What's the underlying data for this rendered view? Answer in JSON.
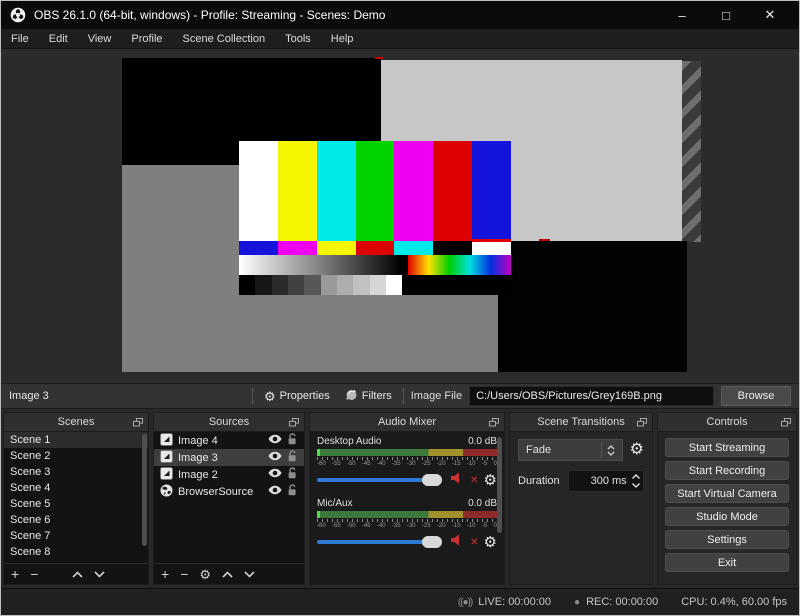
{
  "window": {
    "title": "OBS 26.1.0 (64-bit, windows) - Profile: Streaming - Scenes: Demo",
    "minimize": "–",
    "maximize": "□",
    "close": "✕"
  },
  "menu": {
    "items": [
      "File",
      "Edit",
      "View",
      "Profile",
      "Scene Collection",
      "Tools",
      "Help"
    ]
  },
  "toolbar": {
    "source_label": "Image 3",
    "properties_label": "Properties",
    "filters_label": "Filters",
    "image_file_label": "Image File",
    "image_file_path": "C:/Users/OBS/Pictures/Grey169B.png",
    "browse_label": "Browse"
  },
  "scenes": {
    "title": "Scenes",
    "selected": "Scene 1",
    "items": [
      "Scene 1",
      "Scene 2",
      "Scene 3",
      "Scene 4",
      "Scene 5",
      "Scene 6",
      "Scene 7",
      "Scene 8"
    ]
  },
  "sources": {
    "title": "Sources",
    "items": [
      {
        "name": "Image 4",
        "type": "image"
      },
      {
        "name": "Image 3",
        "type": "image",
        "selected": true
      },
      {
        "name": "Image 2",
        "type": "image"
      },
      {
        "name": "BrowserSource",
        "type": "browser"
      }
    ]
  },
  "audio_mixer": {
    "title": "Audio Mixer",
    "scale_ticks": [
      "-60",
      "-55",
      "-50",
      "-45",
      "-40",
      "-35",
      "-30",
      "-25",
      "-20",
      "-15",
      "-10",
      "-5",
      "0"
    ],
    "channels": [
      {
        "name": "Desktop Audio",
        "level_db": "0.0 dB",
        "muted": true
      },
      {
        "name": "Mic/Aux",
        "level_db": "0.0 dB",
        "muted": true
      }
    ],
    "mute_x": "✕"
  },
  "transitions": {
    "title": "Scene Transitions",
    "transition": "Fade",
    "duration_label": "Duration",
    "duration_value": "300 ms"
  },
  "controls": {
    "title": "Controls",
    "buttons": [
      "Start Streaming",
      "Start Recording",
      "Start Virtual Camera",
      "Studio Mode",
      "Settings",
      "Exit"
    ]
  },
  "statusbar": {
    "live_icon": "((●))",
    "live_label": "LIVE: 00:00:00",
    "rec_icon": "●",
    "rec_label": "REC: 00:00:00",
    "cpu_label": "CPU: 0.4%, 60.00 fps"
  },
  "glyphs": {
    "plus": "+",
    "minus": "−",
    "gear": "⚙"
  },
  "colors": {
    "accent_blue": "#2f7cd6",
    "mute_red": "#c83232",
    "selection_red": "#d00000",
    "meter_green": "#3c7a3c",
    "meter_yellow": "#a3922c",
    "meter_red": "#8e2a2a"
  }
}
